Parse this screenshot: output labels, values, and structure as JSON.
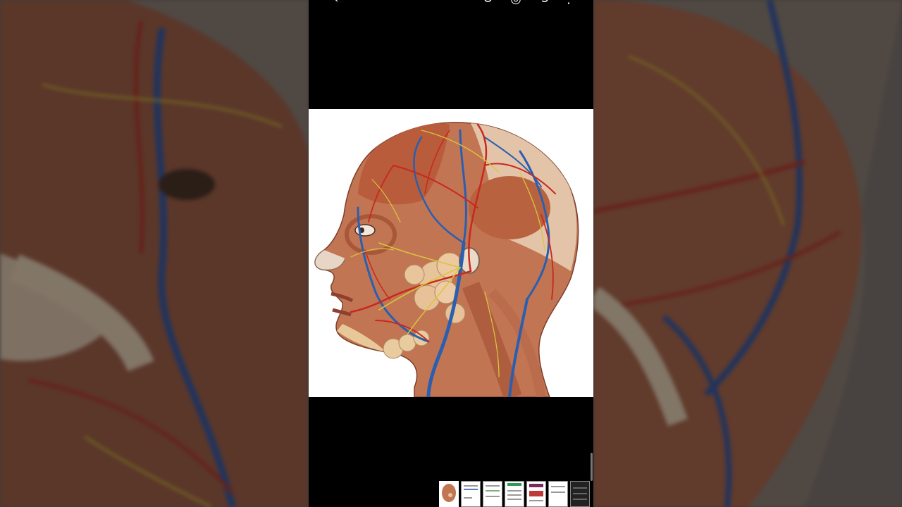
{
  "app": {
    "screen": "image-viewer"
  },
  "toolbar": {
    "items": [
      {
        "name": "back",
        "icon": "arrow-left-icon",
        "glyph": "‹"
      },
      {
        "name": "rotate",
        "icon": "rotate-icon",
        "glyph": "↻"
      },
      {
        "name": "lens",
        "icon": "lens-icon",
        "glyph": "◎"
      },
      {
        "name": "share",
        "icon": "share-icon",
        "glyph": "⟲"
      },
      {
        "name": "more",
        "icon": "more-vertical-icon",
        "glyph": "⋮"
      }
    ]
  },
  "viewer": {
    "subject": "anatomical-head-illustration",
    "background_color": "#ffffff"
  },
  "thumbnails": {
    "count": 7,
    "active_index": 0,
    "items": [
      {
        "kind": "anatomy-head",
        "color": "#c9866a"
      },
      {
        "kind": "document",
        "color": "#ffffff"
      },
      {
        "kind": "document",
        "color": "#ffffff"
      },
      {
        "kind": "document",
        "color": "#2e9b5a"
      },
      {
        "kind": "document",
        "color": "#7a2a5a"
      },
      {
        "kind": "document",
        "color": "#ffffff"
      },
      {
        "kind": "dark-page",
        "color": "#222222"
      }
    ]
  },
  "colors": {
    "frame": "#000000",
    "muscle": "#b8603f",
    "artery": "#c8281e",
    "vein": "#2a5fb0",
    "nerve": "#d7c63c",
    "gland": "#e6c08e",
    "skin": "#e9cdb1"
  }
}
